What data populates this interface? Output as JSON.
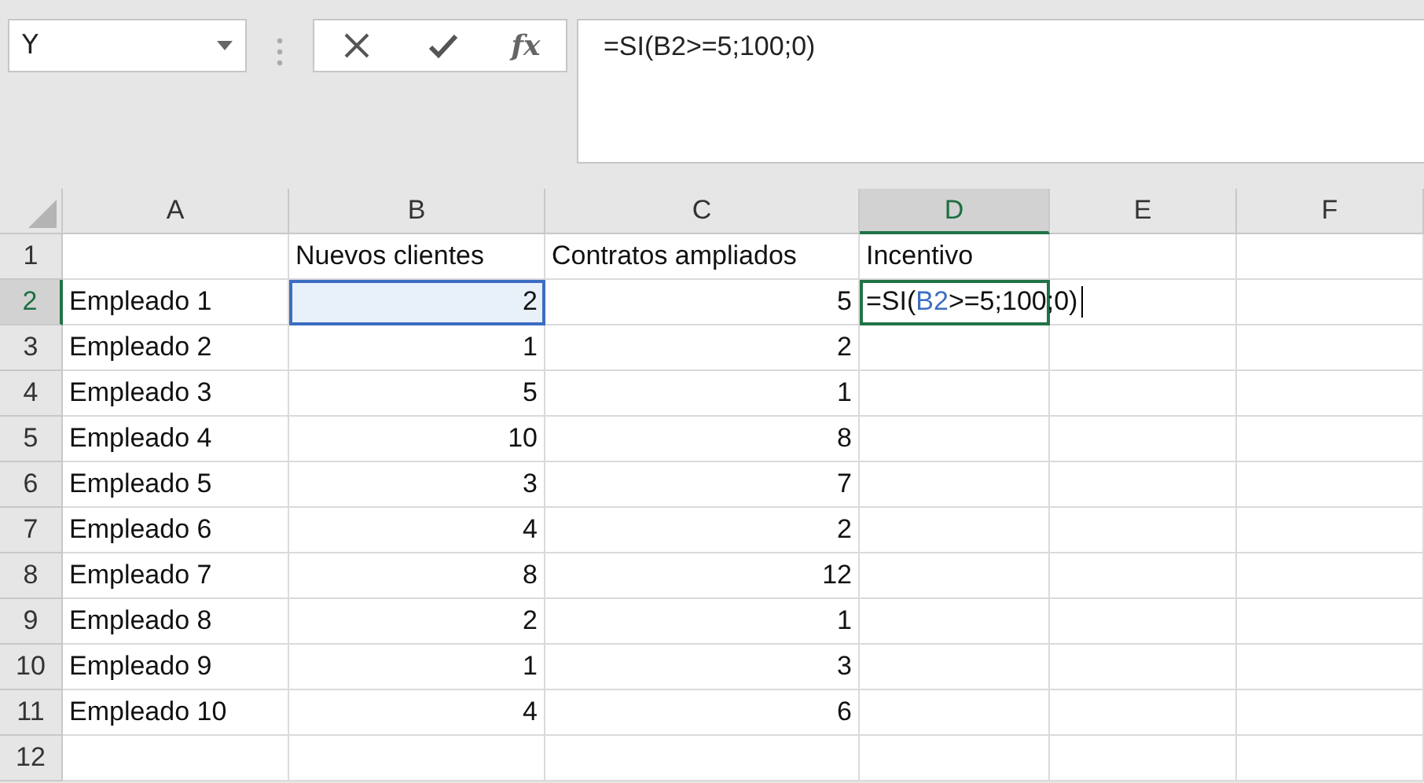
{
  "name_box": {
    "value": "Y"
  },
  "function_button": {
    "label": "fx"
  },
  "formula_bar": {
    "value": "=SI(B2>=5;100;0)"
  },
  "columns": [
    {
      "label": "A",
      "selected": false
    },
    {
      "label": "B",
      "selected": false
    },
    {
      "label": "C",
      "selected": false
    },
    {
      "label": "D",
      "selected": true
    },
    {
      "label": "E",
      "selected": false
    },
    {
      "label": "F",
      "selected": false
    }
  ],
  "rows": [
    {
      "number": "1",
      "selected": false,
      "kind": "header",
      "b": "Nuevos clientes",
      "c": "Contratos ampliados",
      "d": "Incentivo"
    },
    {
      "number": "2",
      "selected": true,
      "kind": "data",
      "a": "Empleado 1",
      "b": "2",
      "c": "5",
      "b_referenced": true,
      "editing": [
        {
          "text": "=SI(",
          "kind": "plain"
        },
        {
          "text": "B2",
          "kind": "reference"
        },
        {
          "text": ">=5;100;0)",
          "kind": "plain"
        }
      ]
    },
    {
      "number": "3",
      "selected": false,
      "kind": "data",
      "a": "Empleado 2",
      "b": "1",
      "c": "2"
    },
    {
      "number": "4",
      "selected": false,
      "kind": "data",
      "a": "Empleado 3",
      "b": "5",
      "c": "1"
    },
    {
      "number": "5",
      "selected": false,
      "kind": "data",
      "a": "Empleado 4",
      "b": "10",
      "c": "8"
    },
    {
      "number": "6",
      "selected": false,
      "kind": "data",
      "a": "Empleado 5",
      "b": "3",
      "c": "7"
    },
    {
      "number": "7",
      "selected": false,
      "kind": "data",
      "a": "Empleado 6",
      "b": "4",
      "c": "2"
    },
    {
      "number": "8",
      "selected": false,
      "kind": "data",
      "a": "Empleado 7",
      "b": "8",
      "c": "12"
    },
    {
      "number": "9",
      "selected": false,
      "kind": "data",
      "a": "Empleado 8",
      "b": "2",
      "c": "1"
    },
    {
      "number": "10",
      "selected": false,
      "kind": "data",
      "a": "Empleado 9",
      "b": "1",
      "c": "3"
    },
    {
      "number": "11",
      "selected": false,
      "kind": "data",
      "a": "Empleado 10",
      "b": "4",
      "c": "6"
    },
    {
      "number": "12",
      "selected": false,
      "kind": "data"
    }
  ]
}
